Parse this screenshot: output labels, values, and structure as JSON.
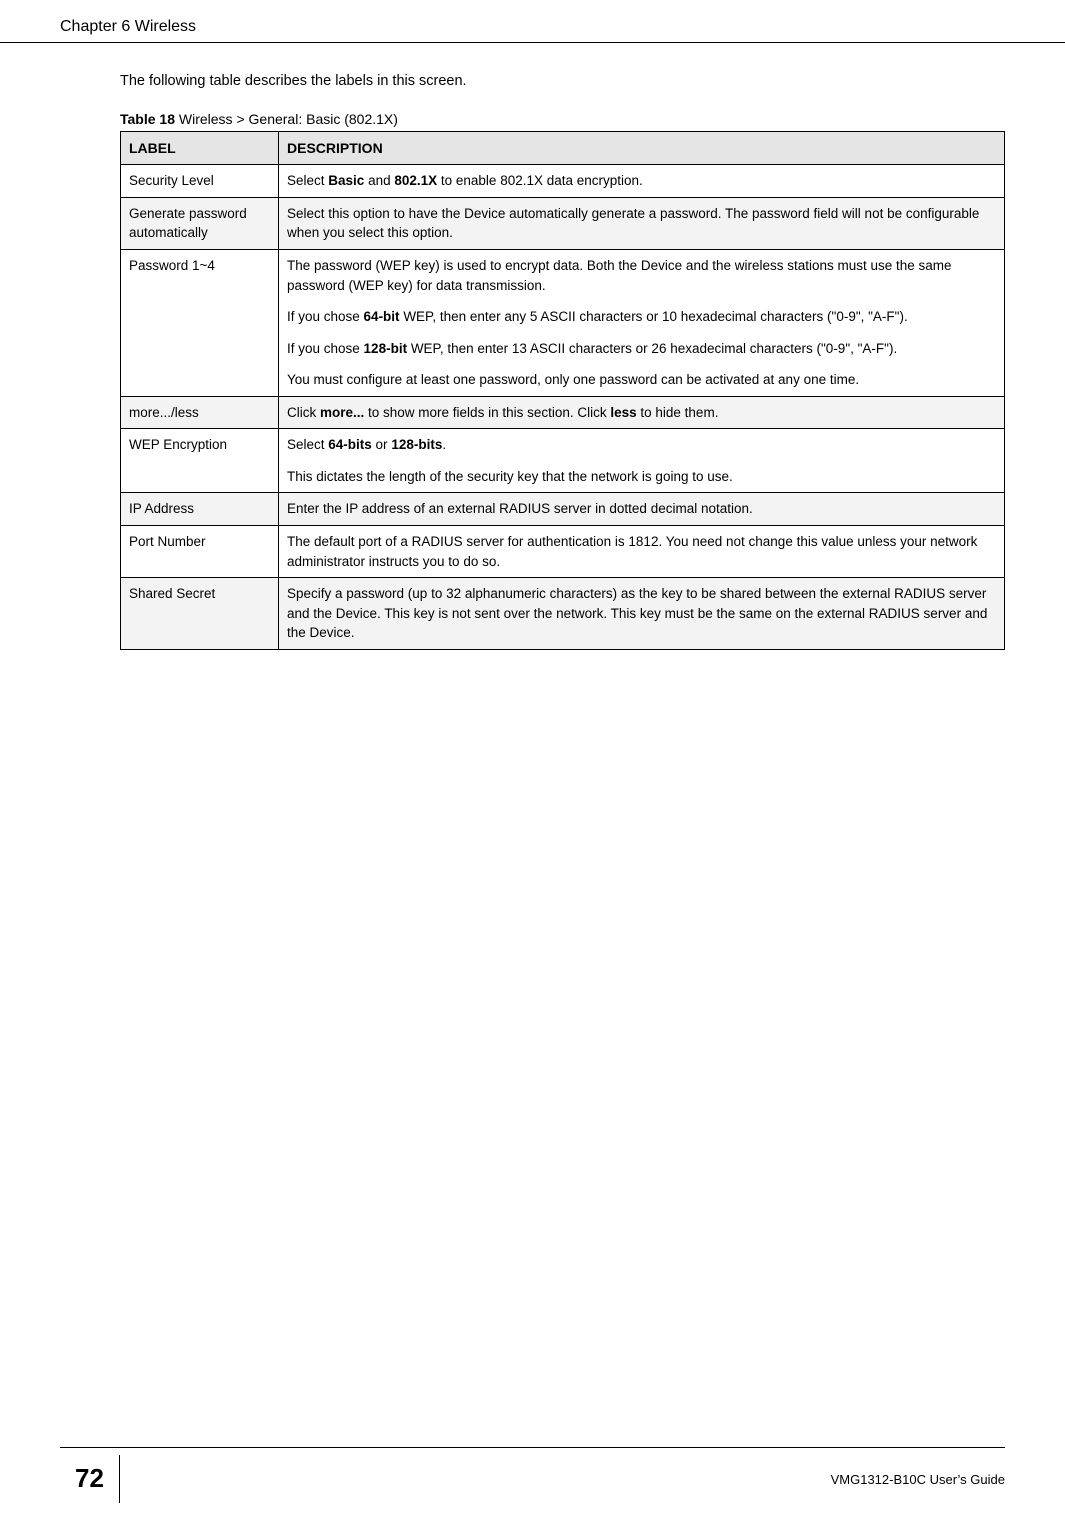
{
  "header": {
    "chapter": "Chapter 6 Wireless"
  },
  "intro": "The following table describes the labels in this screen.",
  "table": {
    "caption_prefix": "Table 18",
    "caption_rest": "   Wireless > General: Basic (802.1X)",
    "headers": {
      "label": "LABEL",
      "description": "DESCRIPTION"
    },
    "rows": [
      {
        "label": "Security Level",
        "desc_parts": [
          {
            "t": "Select ",
            "b": false
          },
          {
            "t": "Basic",
            "b": true
          },
          {
            "t": " and ",
            "b": false
          },
          {
            "t": "802.1X",
            "b": true
          },
          {
            "t": " to enable 802.1X data encryption.",
            "b": false
          }
        ]
      },
      {
        "label": "Generate password automatically",
        "desc_parts": [
          {
            "t": "Select this option to have the Device automatically generate a password. The password field will not be configurable when you select this option.",
            "b": false
          }
        ],
        "shaded": true
      },
      {
        "label": "Password 1~4",
        "paragraphs": [
          [
            {
              "t": "The password (WEP key) is used to encrypt data. Both the Device and the wireless stations must use the same password (WEP key) for data transmission.",
              "b": false
            }
          ],
          [
            {
              "t": "If you chose ",
              "b": false
            },
            {
              "t": "64-bit",
              "b": true
            },
            {
              "t": " WEP, then enter any 5 ASCII characters or 10 hexadecimal characters (\"0-9\", \"A-F\").",
              "b": false
            }
          ],
          [
            {
              "t": "If you chose ",
              "b": false
            },
            {
              "t": "128-bit",
              "b": true
            },
            {
              "t": " WEP, then enter 13 ASCII characters or 26 hexadecimal characters (\"0-9\", \"A-F\").",
              "b": false
            }
          ],
          [
            {
              "t": "You must configure at least one password, only one password can be activated at any one time.",
              "b": false
            }
          ]
        ]
      },
      {
        "label": "more.../less",
        "desc_parts": [
          {
            "t": "Click ",
            "b": false
          },
          {
            "t": "more...",
            "b": true
          },
          {
            "t": " to show more fields in this section. Click ",
            "b": false
          },
          {
            "t": "less",
            "b": true
          },
          {
            "t": " to hide them.",
            "b": false
          }
        ],
        "shaded": true
      },
      {
        "label": "WEP Encryption",
        "paragraphs": [
          [
            {
              "t": "Select ",
              "b": false
            },
            {
              "t": "64-bits",
              "b": true
            },
            {
              "t": " or ",
              "b": false
            },
            {
              "t": "128-bits",
              "b": true
            },
            {
              "t": ".",
              "b": false
            }
          ],
          [
            {
              "t": "This dictates the length of the security key that the network is going to use.",
              "b": false
            }
          ]
        ]
      },
      {
        "label": "IP Address",
        "desc_parts": [
          {
            "t": "Enter the IP address of an external RADIUS server in dotted decimal notation.",
            "b": false
          }
        ],
        "shaded": true
      },
      {
        "label": "Port Number",
        "desc_parts": [
          {
            "t": "The default port of a RADIUS server for authentication is 1812. You need not change this value unless your network administrator instructs you to do so.",
            "b": false
          }
        ]
      },
      {
        "label": "Shared Secret",
        "desc_parts": [
          {
            "t": "Specify a password (up to 32 alphanumeric characters) as the key to be shared between the external RADIUS server and the Device. This key is not sent over the network. This key must be the same on the external RADIUS server and the Device.",
            "b": false
          }
        ],
        "shaded": true
      }
    ]
  },
  "footer": {
    "page_number": "72",
    "guide_name": "VMG1312-B10C User’s Guide"
  }
}
